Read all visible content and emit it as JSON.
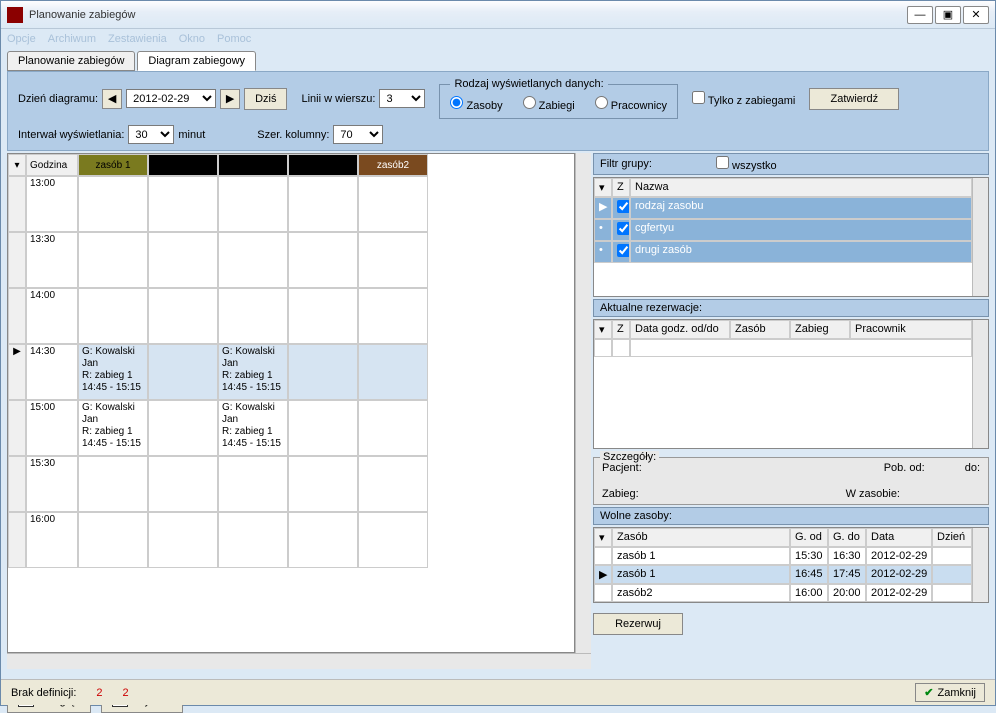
{
  "window": {
    "title": "Planowanie zabiegów"
  },
  "menu": [
    "Opcje",
    "Archiwum",
    "Zestawienia",
    "Okno",
    "Pomoc"
  ],
  "tabs": {
    "tab1": "Planowanie zabiegów",
    "tab2": "Diagram zabiegowy",
    "active": 1
  },
  "toolbar": {
    "day_label": "Dzień diagramu:",
    "date": "2012-02-29",
    "today_btn": "Dziś",
    "interval_label": "Interwał wyświetlania:",
    "interval": "30",
    "interval_unit": "minut",
    "lines_label": "Linii w wierszu:",
    "lines": "3",
    "colw_label": "Szer. kolumny:",
    "colw": "70",
    "radio_legend": "Rodzaj wyświetlanych danych:",
    "radio_resources": "Zasoby",
    "radio_treatments": "Zabiegi",
    "radio_staff": "Pracownicy",
    "only_with": "Tylko z zabiegami",
    "confirm": "Zatwierdź"
  },
  "schedule": {
    "hour_header": "Godzina",
    "resources": [
      "zasób 1",
      "",
      "",
      "",
      "zasób2"
    ],
    "res_colors": [
      "res-olive",
      "res-black",
      "res-black",
      "res-black",
      "res-brown"
    ],
    "hours": [
      "13:00",
      "13:30",
      "14:00",
      "14:30",
      "15:00",
      "15:30",
      "16:00"
    ],
    "current_row_index": 3,
    "appointments": {
      "r3c0": "G: Kowalski Jan\nR:  zabieg 1\n14:45 - 15:15",
      "r3c2": "G: Kowalski Jan\nR:  zabieg 1\n14:45 - 15:15",
      "r4c0": "G: Kowalski Jan\nR:  zabieg 1\n14:45 - 15:15",
      "r4c2": "G: Kowalski Jan\nR:  zabieg 1\n14:45 - 15:15"
    }
  },
  "buttons": {
    "preview": "Podgląd",
    "print": "Wydruk",
    "reserve": "Rezerwuj",
    "close": "Zamknij"
  },
  "rightpanel": {
    "filter_label": "Filtr grupy:",
    "all_checkbox": "wszystko",
    "filter_cols": {
      "z": "Z",
      "name": "Nazwa"
    },
    "filter_rows": [
      {
        "z": true,
        "name": "rodzaj zasobu"
      },
      {
        "z": true,
        "name": "cgfertyu"
      },
      {
        "z": true,
        "name": "drugi zasób"
      }
    ],
    "reservations_title": "Aktualne rezerwacje:",
    "res_cols": {
      "z": "Z",
      "dt": "Data godz. od/do",
      "res": "Zasób",
      "treat": "Zabieg",
      "staff": "Pracownik"
    },
    "details": {
      "legend": "Szczegóły:",
      "patient_lbl": "Pacjent:",
      "from_lbl": "Pob. od:",
      "to_lbl": "do:",
      "treat_lbl": "Zabieg:",
      "inres_lbl": "W zasobie:"
    },
    "free_title": "Wolne zasoby:",
    "free_cols": {
      "res": "Zasób",
      "from": "G. od",
      "to": "G. do",
      "date": "Data",
      "day": "Dzień"
    },
    "free_rows": [
      {
        "res": "zasób 1",
        "from": "15:30",
        "to": "16:30",
        "date": "2012-02-29",
        "day": ""
      },
      {
        "res": "zasób 1",
        "from": "16:45",
        "to": "17:45",
        "date": "2012-02-29",
        "day": ""
      },
      {
        "res": "zasób2",
        "from": "16:00",
        "to": "20:00",
        "date": "2012-02-29",
        "day": ""
      }
    ]
  },
  "footer": {
    "label": "Brak definicji:",
    "n1": "2",
    "n2": "2"
  }
}
